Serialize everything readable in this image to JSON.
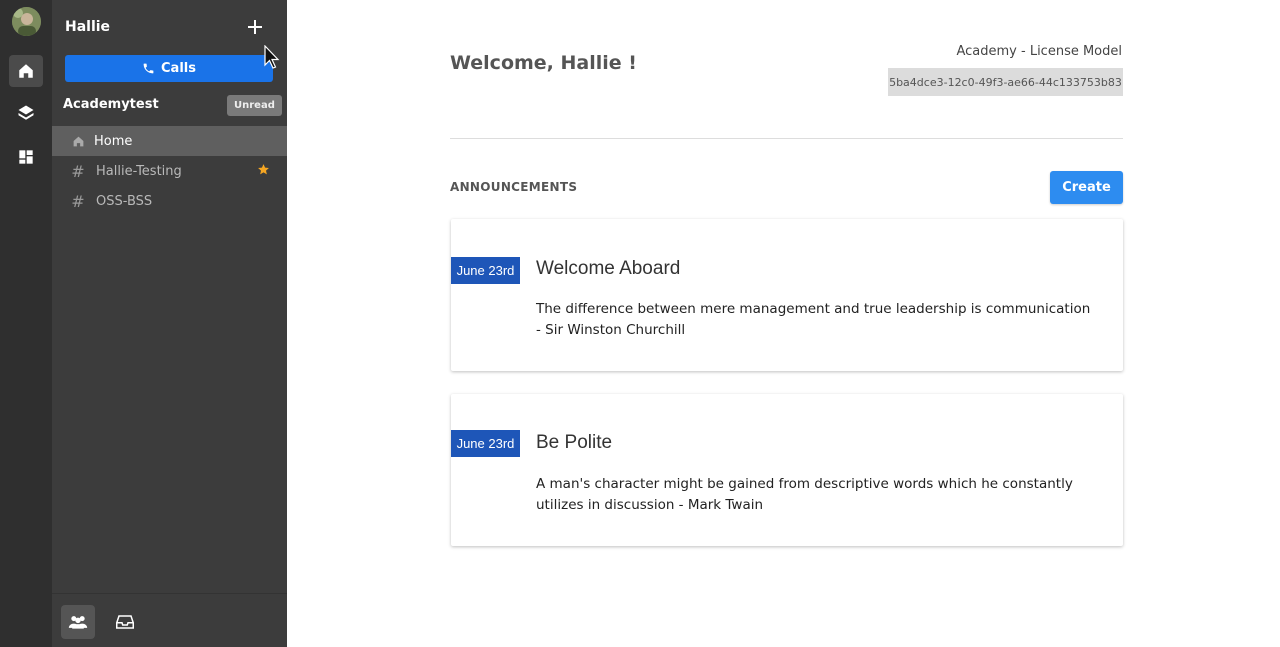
{
  "sidebar": {
    "team_name": "Hallie",
    "calls_label": "Calls",
    "workspace_name": "Academytest",
    "unread_label": "Unread",
    "channels": [
      {
        "label": "Home",
        "icon": "home-icon",
        "active": true
      },
      {
        "label": "Hallie-Testing",
        "icon": "hash-icon",
        "starred": true
      },
      {
        "label": "OSS-BSS",
        "icon": "hash-icon"
      }
    ]
  },
  "header": {
    "welcome": "Welcome, Hallie !",
    "license_label": "Academy - License Model",
    "license_id": "5ba4dce3-12c0-49f3-ae66-44c133753b83"
  },
  "announcements": {
    "title": "ANNOUNCEMENTS",
    "create_label": "Create",
    "items": [
      {
        "date": "June 23rd",
        "title": "Welcome Aboard",
        "body": "The difference between mere management and true leadership is communication - Sir Winston Churchill"
      },
      {
        "date": "June 23rd",
        "title": "Be Polite",
        "body": "A man's character might be gained from descriptive words which he constantly utilizes in discussion - Mark Twain"
      }
    ]
  },
  "colors": {
    "accent": "#1a73e8",
    "date_badge": "#1e56b8",
    "star": "#f5a623"
  }
}
